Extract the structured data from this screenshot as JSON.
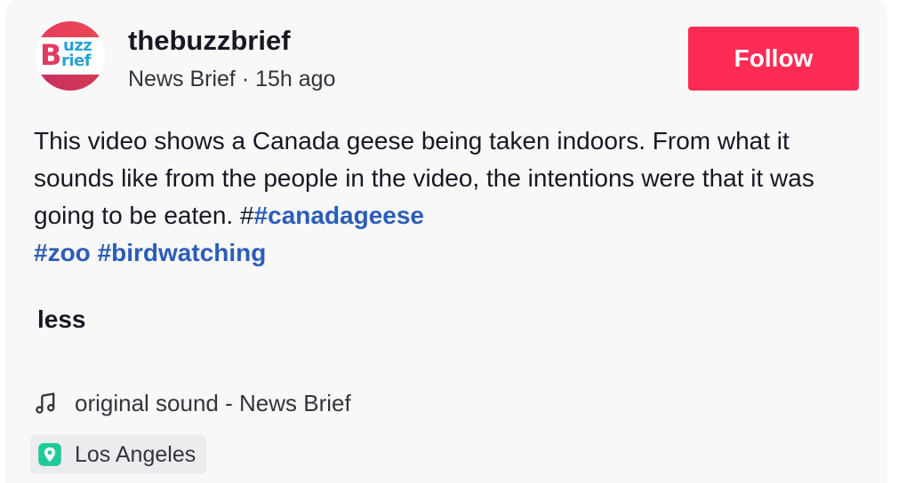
{
  "author": {
    "username": "thebuzzbrief",
    "display_name": "News Brief",
    "posted_ago": "15h ago",
    "separator": " · ",
    "avatar": {
      "logo_b": "B",
      "logo_top": "uzz",
      "logo_bottom": "rief",
      "colors": {
        "accent": "#e23a63",
        "secondary": "#2aa2d8"
      }
    }
  },
  "follow_button": {
    "label": "Follow",
    "color": "#fe2c55"
  },
  "description": {
    "text": "This video shows a Canada geese being taken indoors. From what it sounds like from the people in the video, the intentions were that it was going to be eaten. #",
    "hashtags": [
      "#canadageese",
      "#zoo",
      "#birdwatching"
    ],
    "hashtag_color": "#2b5db9"
  },
  "toggle": {
    "label": "less"
  },
  "music": {
    "icon": "music-note-icon",
    "label": "original sound - News Brief"
  },
  "location": {
    "icon": "location-pin-icon",
    "label": "Los Angeles",
    "icon_color": "#20c99a"
  }
}
